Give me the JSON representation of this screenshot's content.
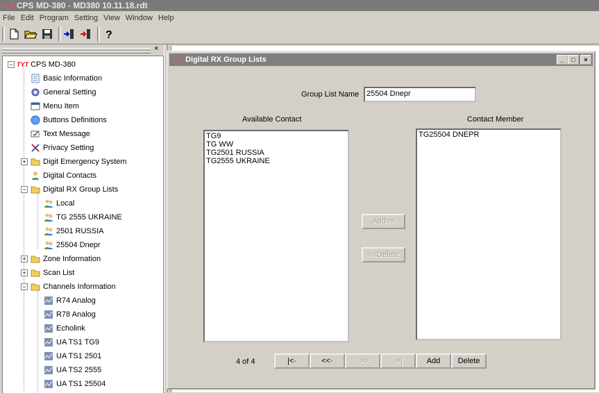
{
  "app": {
    "title": "CPS MD-380 - MD380 10.11.18.rdt",
    "logo_text": "TYT"
  },
  "menu": [
    "File",
    "Edit",
    "Program",
    "Setting",
    "View",
    "Window",
    "Help"
  ],
  "toolbar_icons": [
    "new-file-icon",
    "open-folder-icon",
    "save-disk-icon",
    "read-radio-icon",
    "write-radio-icon",
    "help-icon"
  ],
  "tree": {
    "root": "CPS MD-380",
    "items": [
      "Basic Information",
      "General Setting",
      "Menu Item",
      "Buttons Definitions",
      "Text Message",
      "Privacy Setting",
      "Digit Emergency System",
      "Digital Contacts",
      "Digital RX Group Lists",
      "Local",
      "TG 2555 UKRAINE",
      "2501 RUSSIA",
      "25504 Dnepr",
      "Zone Information",
      "Scan List",
      "Channels Information",
      "R74 Analog",
      "R78 Analog",
      "Echolink",
      "UA TS1 TG9",
      "UA TS1 2501",
      "UA TS2 2555",
      "UA TS1 25504"
    ],
    "close_glyph": "×"
  },
  "dialog": {
    "title": "Digital RX Group Lists",
    "group_list_name_label": "Group List Name",
    "group_list_name_value": "25504 Dnepr",
    "available_label": "Available Contact",
    "member_label": "Contact Member",
    "available": [
      "TG9",
      "TG WW",
      "TG2501 RUSSIA",
      "TG2555 UKRAINE"
    ],
    "members": [
      "TG25504 DNEPR"
    ],
    "add_btn": "Add>>",
    "delete_btn": "<<Delete",
    "page_counter": "4 of 4",
    "nav": {
      "first": "|<·",
      "prev": "<<·",
      "next": "·>>",
      "last": "·>|",
      "add": "Add",
      "delete": "Delete"
    },
    "win_buttons": {
      "min": "_",
      "max": "□",
      "close": "×"
    }
  }
}
